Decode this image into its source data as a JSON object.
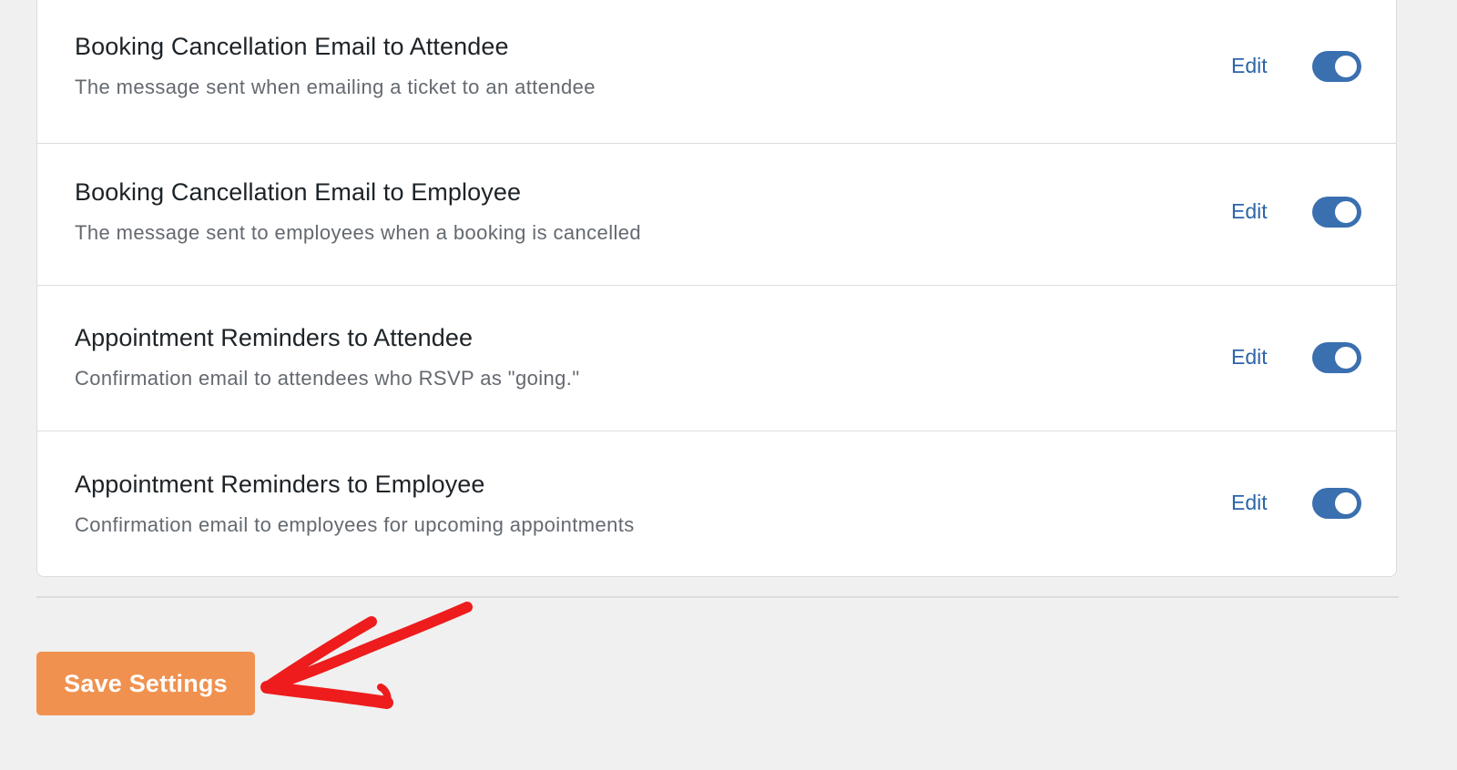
{
  "notifications": [
    {
      "title": "Booking Cancellation Email to Attendee",
      "description": "The message sent when emailing a ticket to an attendee",
      "edit_label": "Edit",
      "enabled": true
    },
    {
      "title": "Booking Cancellation Email to Employee",
      "description": "The message sent to employees when a booking is cancelled",
      "edit_label": "Edit",
      "enabled": true
    },
    {
      "title": "Appointment Reminders to Attendee",
      "description": "Confirmation email to attendees who RSVP as \"going.\"",
      "edit_label": "Edit",
      "enabled": true
    },
    {
      "title": "Appointment Reminders to Employee",
      "description": "Confirmation email to employees for upcoming appointments",
      "edit_label": "Edit",
      "enabled": true
    }
  ],
  "save_button": {
    "label": "Save Settings"
  },
  "colors": {
    "accent": "#3a6fb0",
    "link": "#2c65a7",
    "save_button": "#f0914f",
    "annotation_arrow": "#ee1c1c",
    "background": "#f0f0f1"
  },
  "annotation": {
    "icon": "arrow-annotation-icon"
  }
}
